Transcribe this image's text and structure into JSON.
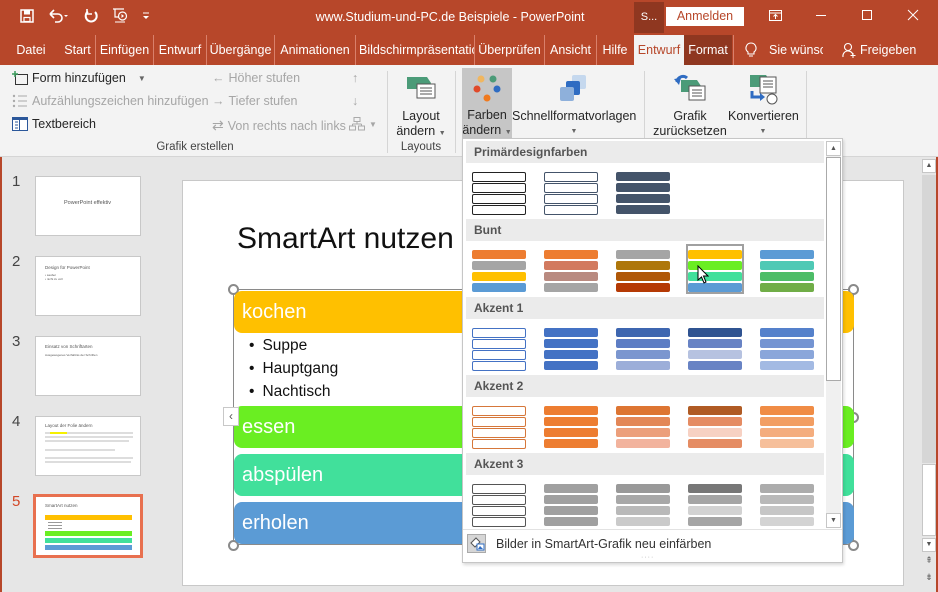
{
  "titlebar": {
    "title": "www.Studium-und-PC.de Beispiele  -  PowerPoint",
    "qat": [
      "save-icon",
      "undo-icon",
      "redo-icon",
      "start-from-beginning-icon",
      "customize-qat-icon"
    ],
    "s_button": "S...",
    "login": "Anmelden",
    "window_buttons": {
      "restore_ribbon": "⊡",
      "minimize": "—",
      "maximize": "☐",
      "close": "✕"
    }
  },
  "tabs": [
    {
      "label": "Datei"
    },
    {
      "label": "Start"
    },
    {
      "label": "Einfügen"
    },
    {
      "label": "Entwurf"
    },
    {
      "label": "Übergänge"
    },
    {
      "label": "Animationen"
    },
    {
      "label": "Bildschirmpräsentation"
    },
    {
      "label": "Überprüfen"
    },
    {
      "label": "Ansicht"
    },
    {
      "label": "Hilfe"
    },
    {
      "label": "Entwurf",
      "active": true
    },
    {
      "label": "Format",
      "contextual": true
    }
  ],
  "tell_me": "Sie wünsc",
  "share": "Freigeben",
  "ribbon": {
    "grafik_erstellen": {
      "label": "Grafik erstellen",
      "form_hinzufuegen": "Form hinzufügen",
      "aufzaehlung": "Aufzählungszeichen hinzufügen",
      "textbereich": "Textbereich",
      "hoeher": "Höher stufen",
      "tiefer": "Tiefer stufen",
      "rtl": "Von rechts nach links"
    },
    "layouts": {
      "label": "Layouts",
      "layout_line1": "Layout",
      "layout_line2": "ändern"
    },
    "farben": {
      "line1": "Farben",
      "line2": "ändern"
    },
    "schnellformat": "Schnellformatvorlagen",
    "grafik_zurueck": {
      "line1": "Grafik",
      "line2": "zurücksetzen"
    },
    "konvertieren": "Konvertieren"
  },
  "thumbnails": [
    {
      "num": "1",
      "title": "PowerPoint effektiv"
    },
    {
      "num": "2",
      "title": "Design für PowerPoint",
      "lines": [
        "• sauber",
        "• nicht zu voll"
      ]
    },
    {
      "num": "3",
      "title": "Einsatz von Schriftarten",
      "lines": [
        "Ausgewogenes Verhältnis der Schriften"
      ]
    },
    {
      "num": "4",
      "title": "Layout der Folie ändern",
      "lines": [
        "Text mit Hervorhebung..."
      ]
    },
    {
      "num": "5",
      "title": "SmartArt nutzen",
      "selected": true
    }
  ],
  "slide": {
    "title": "SmartArt nutzen",
    "items": [
      {
        "label": "kochen",
        "color": "#ffc000",
        "bullets": [
          "Suppe",
          "Hauptgang",
          "Nachtisch"
        ]
      },
      {
        "label": "essen",
        "color": "#6aee22"
      },
      {
        "label": "abspülen",
        "color": "#41e09b"
      },
      {
        "label": "erholen",
        "color": "#5b9bd5"
      }
    ]
  },
  "color_dropdown": {
    "sections": [
      {
        "title": "Primärdesignfarben",
        "variants": [
          {
            "type": "outline",
            "stroke": "#222222"
          },
          {
            "type": "outline",
            "stroke": "#44546a"
          },
          {
            "type": "fill",
            "colors": [
              "#44546a",
              "#44546a",
              "#44546a",
              "#44546a"
            ]
          }
        ]
      },
      {
        "title": "Bunt",
        "variants": [
          {
            "type": "fill",
            "colors": [
              "#ed7d31",
              "#a5a5a5",
              "#ffc000",
              "#5b9bd5"
            ]
          },
          {
            "type": "fill",
            "colors": [
              "#ed7d31",
              "#d27a5f",
              "#b98a80",
              "#a5a5a5"
            ]
          },
          {
            "type": "fill",
            "colors": [
              "#a5a5a5",
              "#ae770b",
              "#b05808",
              "#b53a05"
            ]
          },
          {
            "type": "fill",
            "colors": [
              "#ffc000",
              "#6aee22",
              "#41e09b",
              "#5b9bd5"
            ],
            "highlighted": true
          },
          {
            "type": "fill",
            "colors": [
              "#5b9bd5",
              "#4fc9b5",
              "#4dbd67",
              "#70ad47"
            ]
          }
        ]
      },
      {
        "title": "Akzent 1",
        "variants": [
          {
            "type": "outline",
            "stroke": "#4472c4"
          },
          {
            "type": "fill",
            "colors": [
              "#4472c4",
              "#4472c4",
              "#4472c4",
              "#4472c4"
            ]
          },
          {
            "type": "fill",
            "colors": [
              "#3e66b0",
              "#5d7dc4",
              "#7b96cf",
              "#9caed9"
            ]
          },
          {
            "type": "fill",
            "colors": [
              "#2f5391",
              "#6883c4",
              "#b6c2e0",
              "#6883c4"
            ]
          },
          {
            "type": "fill",
            "colors": [
              "#5581cb",
              "#7494d2",
              "#8aa6da",
              "#a3bae3"
            ]
          }
        ]
      },
      {
        "title": "Akzent 2",
        "variants": [
          {
            "type": "outline",
            "stroke": "#d6773a"
          },
          {
            "type": "fill",
            "colors": [
              "#ed7d31",
              "#ed7d31",
              "#ed7d31",
              "#ed7d31"
            ]
          },
          {
            "type": "fill",
            "colors": [
              "#dd7532",
              "#e38757",
              "#ec9f7b",
              "#f2b39d"
            ]
          },
          {
            "type": "fill",
            "colors": [
              "#b05b24",
              "#e58c63",
              "#f7d1c3",
              "#e58c63"
            ]
          },
          {
            "type": "fill",
            "colors": [
              "#f08c45",
              "#f29e63",
              "#f4ad7e",
              "#f6bf9a"
            ]
          }
        ]
      },
      {
        "title": "Akzent 3",
        "variants": [
          {
            "type": "outline",
            "stroke": "#555555"
          },
          {
            "type": "fill",
            "colors": [
              "#a0a0a0",
              "#a0a0a0",
              "#a0a0a0",
              "#a0a0a0"
            ]
          },
          {
            "type": "fill",
            "colors": [
              "#999999",
              "#a8a8a8",
              "#b9b9b9",
              "#cacaca"
            ]
          },
          {
            "type": "fill",
            "colors": [
              "#777777",
              "#a5a5a5",
              "#d2d2d2",
              "#a5a5a5"
            ]
          },
          {
            "type": "fill",
            "colors": [
              "#acacac",
              "#b9b9b9",
              "#c6c6c6",
              "#d3d3d3"
            ]
          }
        ]
      }
    ],
    "footer": "Bilder in SmartArt-Grafik neu einfärben",
    "footer_access_key": "r"
  }
}
